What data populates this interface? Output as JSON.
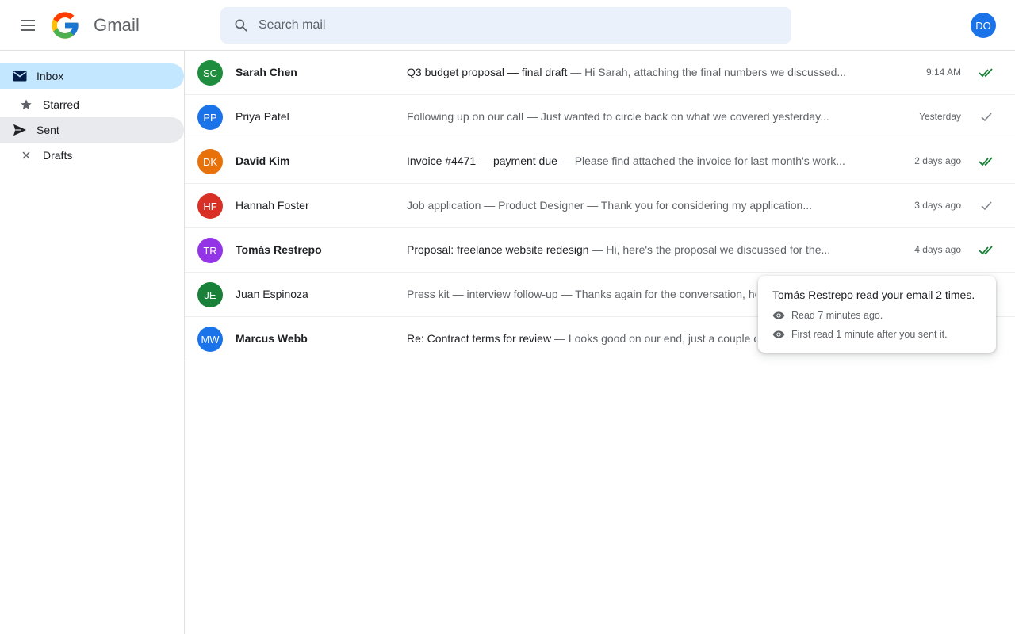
{
  "app": {
    "title": "Gmail"
  },
  "search": {
    "placeholder": "Search mail"
  },
  "user": {
    "initials": "DO",
    "color": "#1a73e8"
  },
  "sidebar": {
    "items": [
      {
        "label": "Inbox",
        "icon": "inbox-icon",
        "state": "active"
      },
      {
        "label": "Starred",
        "icon": "star-icon",
        "state": ""
      },
      {
        "label": "Sent",
        "icon": "send-icon",
        "state": "hover"
      },
      {
        "label": "Drafts",
        "icon": "close-icon",
        "state": ""
      }
    ]
  },
  "emails": [
    {
      "initials": "SC",
      "color": "#1e8e3e",
      "sender": "Sarah Chen",
      "unread": true,
      "subject": "Q3 budget proposal — final draft",
      "snippet": "Hi Sarah, attaching the final numbers we discussed...",
      "time": "9:14 AM",
      "status": "read",
      "status_icon": "double-check-icon"
    },
    {
      "initials": "PP",
      "color": "#1a73e8",
      "sender": "Priya Patel",
      "unread": false,
      "subject": "Following up on our call",
      "snippet": "Just wanted to circle back on what we covered yesterday...",
      "time": "Yesterday",
      "status": "sent",
      "status_icon": "check-icon"
    },
    {
      "initials": "DK",
      "color": "#e8710a",
      "sender": "David Kim",
      "unread": true,
      "subject": "Invoice #4471 — payment due",
      "snippet": "Please find attached the invoice for last month's work...",
      "time": "2 days ago",
      "status": "read",
      "status_icon": "double-check-icon"
    },
    {
      "initials": "HF",
      "color": "#d93025",
      "sender": "Hannah Foster",
      "unread": false,
      "subject": "Job application — Product Designer",
      "snippet": "Thank you for considering my application...",
      "time": "3 days ago",
      "status": "sent",
      "status_icon": "check-icon"
    },
    {
      "initials": "TR",
      "color": "#9334e6",
      "sender": "Tomás Restrepo",
      "unread": true,
      "subject": "Proposal: freelance website redesign",
      "snippet": "Hi, here's the proposal we discussed for the...",
      "time": "4 days ago",
      "status": "read",
      "status_icon": "double-check-icon"
    },
    {
      "initials": "JE",
      "color": "#188038",
      "sender": "Juan Espinoza",
      "unread": false,
      "subject": "Press kit — interview follow-up",
      "snippet": "Thanks again for the conversation, he",
      "time": "",
      "status": "",
      "status_icon": ""
    },
    {
      "initials": "MW",
      "color": "#1a73e8",
      "sender": "Marcus Webb",
      "unread": true,
      "subject": "Re: Contract terms for review",
      "snippet": "Looks good on our end, just a couple o",
      "time": "",
      "status": "",
      "status_icon": ""
    }
  ],
  "tooltip": {
    "title": "Tomás Restrepo read your email 2 times.",
    "lines": [
      {
        "icon": "eye-icon",
        "text": "Read 7 minutes ago."
      },
      {
        "icon": "eye-icon",
        "text": "First read 1 minute after you sent it."
      }
    ]
  },
  "colors": {
    "read_check": "#188038",
    "sent_check": "#80868b",
    "accent": "#c2e7ff"
  }
}
